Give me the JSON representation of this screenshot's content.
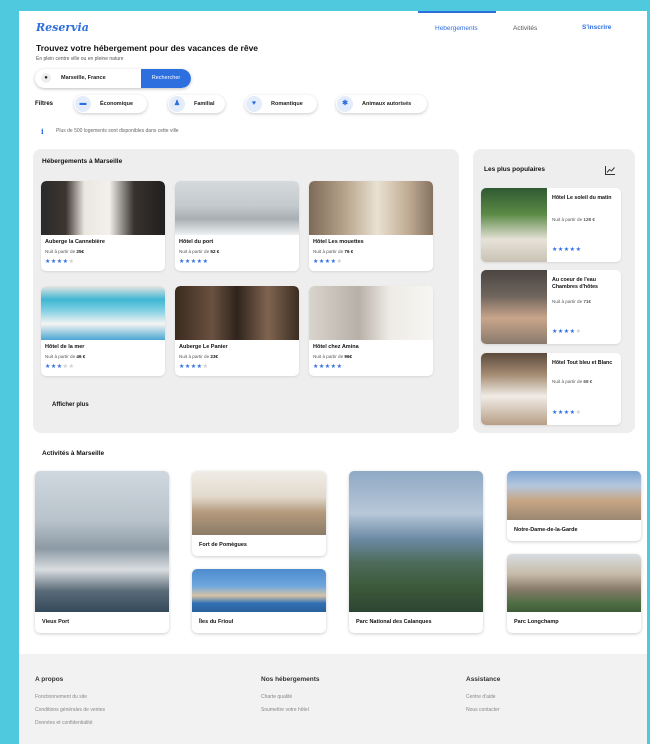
{
  "header": {
    "logo": "Reservia",
    "nav": [
      {
        "label": "Hebergements"
      },
      {
        "label": "Activités"
      }
    ],
    "signup": "S'inscrire"
  },
  "hero": {
    "title": "Trouvez votre hébergement pour des vacances de rêve",
    "subtitle": "En plein centre ville ou en pleine nature"
  },
  "search": {
    "value": "Marseille, France",
    "button": "Rechercher",
    "icon": "map-pin-icon"
  },
  "filters": {
    "label": "Filtres",
    "items": [
      {
        "label": "Économique",
        "icon": "money-icon"
      },
      {
        "label": "Familial",
        "icon": "family-icon"
      },
      {
        "label": "Romantique",
        "icon": "heart-icon"
      },
      {
        "label": "Animaux autorisés",
        "icon": "paw-icon"
      }
    ]
  },
  "info": {
    "text": "Plus de 500 logements sont disponibles dans cette ville"
  },
  "accommodations": {
    "title": "Hébergements à Marseille",
    "items": [
      {
        "name": "Auberge la Cannebière",
        "price_prefix": "Nuit à partir de",
        "price": "25€",
        "rating": 4
      },
      {
        "name": "Hôtel du port",
        "price_prefix": "Nuit à partir de",
        "price": "52 €",
        "rating": 5
      },
      {
        "name": "Hôtel Les mouettes",
        "price_prefix": "Nuit à partir de",
        "price": "76 €",
        "rating": 4
      },
      {
        "name": "Hôtel de la mer",
        "price_prefix": "Nuit à partir de",
        "price": "46 €",
        "rating": 3
      },
      {
        "name": "Auberge Le Panier",
        "price_prefix": "Nuit à partir de",
        "price": "23€",
        "rating": 4
      },
      {
        "name": "Hôtel chez Amina",
        "price_prefix": "Nuit à partir de",
        "price": "96€",
        "rating": 5
      }
    ],
    "more": "Afficher plus"
  },
  "popular": {
    "title": "Les plus populaires",
    "items": [
      {
        "name": "Hôtel Le soleil du matin",
        "price_prefix": "Nuit à partir de",
        "price": "128 €",
        "rating": 5
      },
      {
        "name": "Au coeur de l'eau Chambres d'hôtes",
        "price_prefix": "Nuit à partir de",
        "price": "71€",
        "rating": 4
      },
      {
        "name": "Hôtel Tout bleu et Blanc",
        "price_prefix": "Nuit à partir de",
        "price": "68 €",
        "rating": 4
      }
    ]
  },
  "activities": {
    "title": "Activités à Marseille",
    "items": [
      {
        "name": "Vieux Port"
      },
      {
        "name": "Fort de Pomègues"
      },
      {
        "name": "Îles du Frioul"
      },
      {
        "name": "Parc National des Calanques"
      },
      {
        "name": "Notre-Dame-de-la-Garde"
      },
      {
        "name": "Parc Longchamp"
      }
    ]
  },
  "footer": {
    "columns": [
      {
        "title": "A propos",
        "links": [
          "Fonctionnement du site",
          "Conditions générales de ventes",
          "Données et confidentialité"
        ]
      },
      {
        "title": "Nos hébergements",
        "links": [
          "Charte qualité",
          "Soumettre votre hôtel"
        ]
      },
      {
        "title": "Assistance",
        "links": [
          "Centre d'aide",
          "Nous contacter"
        ]
      }
    ]
  },
  "colors": {
    "accent": "#2e6fe0",
    "background": "#4ec9dd",
    "panel": "#eeeeee"
  }
}
